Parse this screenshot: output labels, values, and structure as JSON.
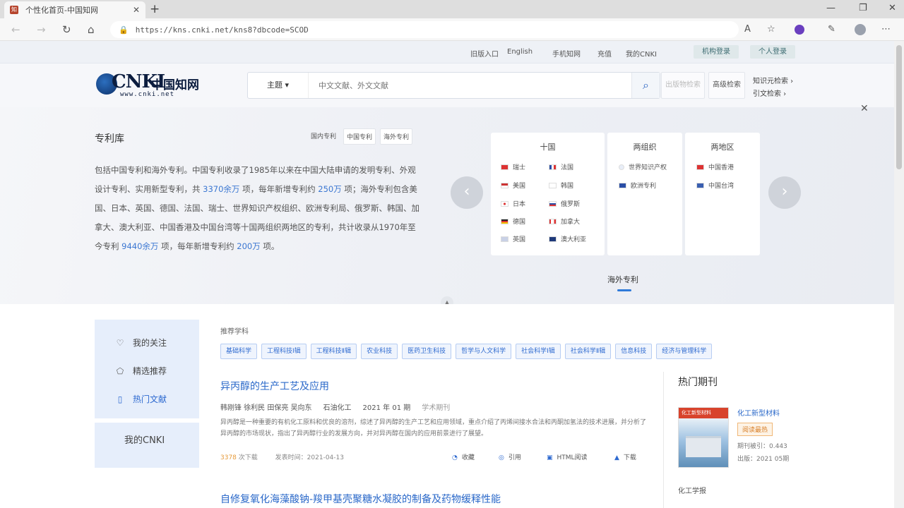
{
  "browser": {
    "tab_title": "个性化首页-中国知网",
    "url": "https://kns.cnki.net/kns8?dbcode=SCOD"
  },
  "topbar": {
    "links": [
      "旧版入口",
      "English",
      "手机知网",
      "充值",
      "我的CNKI"
    ],
    "org_login": "机构登录",
    "personal_login": "个人登录"
  },
  "logo": {
    "brand": "CNKI",
    "cn_name": "中国知网",
    "site": "www.cnki.net"
  },
  "search": {
    "field_label": "主题",
    "placeholder": "中文文献、外文文献",
    "advanced": "高级检索",
    "faint_btn": "出版物检索",
    "kb_link": "知识元检索",
    "ref_link": "引文检索"
  },
  "banner": {
    "title": "专利库",
    "tags": [
      "国内专利",
      "中国专利",
      "海外专利"
    ],
    "desc_parts": [
      "包括中国专利和海外专利。中国专利收录了1985年以来在中国大陆申请的发明专利、外观设计专利、实用新型专利，共 ",
      "3370余万",
      " 项，每年新增专利约 ",
      "250万",
      " 项；海外专利包含美国、日本、英国、德国、法国、瑞士、世界知识产权组织、欧洲专利局、俄罗斯、韩国、加拿大、澳大利亚、中国香港及中国台湾等十国两组织两地区的专利，共计收录从1970年至今专利 ",
      "9440余万",
      " 项，每年新增专利约 ",
      "200万",
      " 项。"
    ],
    "panel_ten": "十国",
    "panel_org": "两组织",
    "panel_region": "两地区",
    "countries": [
      "瑞士",
      "法国",
      "美国",
      "韩国",
      "日本",
      "俄罗斯",
      "德国",
      "加拿大",
      "英国",
      "澳大利亚"
    ],
    "orgs": [
      "世界知识产权",
      "欧洲专利"
    ],
    "regions": [
      "中国香港",
      "中国台湾"
    ],
    "footer": "海外专利"
  },
  "sidebar": {
    "items": [
      {
        "label": "我的关注",
        "icon": "heart-icon"
      },
      {
        "label": "精选推荐",
        "icon": "pentagon-icon"
      },
      {
        "label": "热门文献",
        "icon": "document-icon"
      }
    ],
    "my_cnki": "我的CNKI"
  },
  "subjects": {
    "title": "推荐学科",
    "items": [
      "基础科学",
      "工程科技Ⅰ辑",
      "工程科技Ⅱ辑",
      "农业科技",
      "医药卫生科技",
      "哲学与人文科学",
      "社会科学Ⅰ辑",
      "社会科学Ⅱ辑",
      "信息科技",
      "经济与管理科学"
    ]
  },
  "article": {
    "title": "异丙醇的生产工艺及应用",
    "authors": "韩刚锋 徐利民 田保亮 吴向东",
    "source": "石油化工",
    "issue": "2021 年 01 期",
    "type": "学术期刊",
    "abstract": "异丙醇是一种重要的有机化工原料和优良的溶剂，综述了异丙醇的生产工艺和应用领域，重点介绍了丙烯间接水合法和丙酮加氢法的技术进展，并分析了异丙醇的市场现状，指出了异丙醇行业的发展方向，并对异丙醇在国内的应用前景进行了展望。",
    "downloads_count": "3378",
    "downloads_label": "次下载",
    "published": "发表时间：2021-04-13",
    "actions": [
      "收藏",
      "引用",
      "HTML阅读",
      "下载"
    ],
    "next_title": "自修复氧化海藻酸钠-羧甲基壳聚糖水凝胶的制备及药物缓释性能"
  },
  "hot": {
    "title": "热门期刊",
    "journal": "化工新型材料",
    "cover_text": "化工新型材料",
    "badge": "阅读最热",
    "info1": "期刊被引：0.443",
    "info2": "出版：2021 05期",
    "next": "化工学报"
  }
}
